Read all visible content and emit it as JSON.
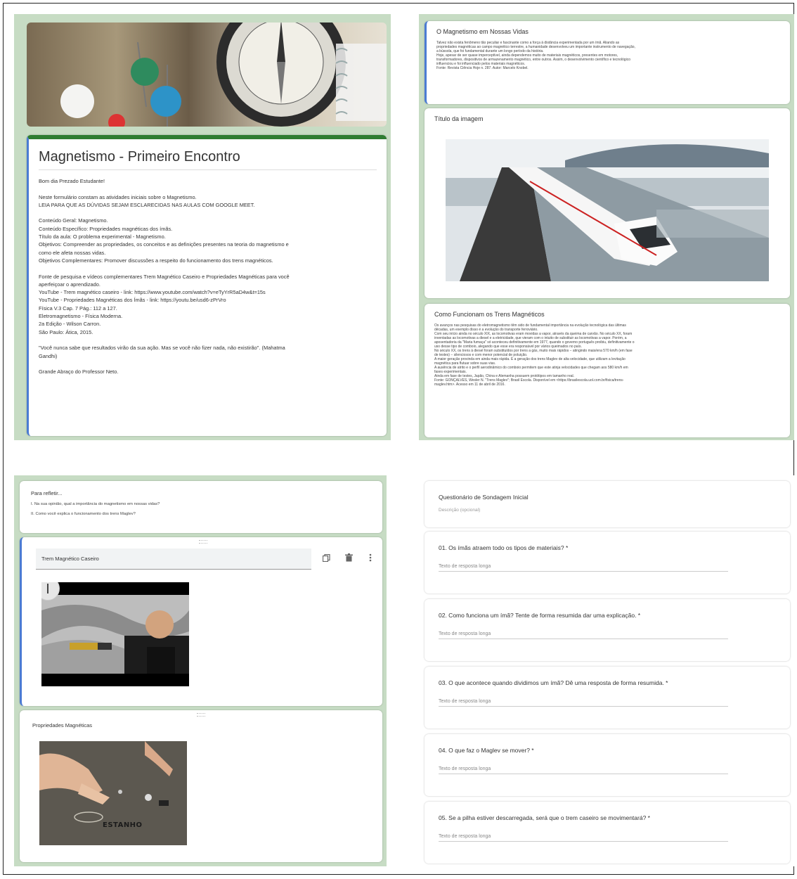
{
  "form1": {
    "title": "Magnetismo - Primeiro Encontro",
    "lines": [
      "Bom dia Prezado Estudante!",
      "",
      "Neste formulário constam as atividades iniciais sobre o Magnetismo.",
      "LEIA PARA QUE AS DÚVIDAS SEJAM ESCLARECIDAS NAS AULAS COM GOOGLE MEET.",
      "",
      "Conteúdo Geral: Magnetismo.",
      "Conteúdo Específico: Propriedades magnéticas dos ímãs.",
      "Título da aula: O problema experimental - Magnetismo.",
      "Objetivos: Compreender as propriedades, os conceitos e as definições presentes na teoria do magnetismo e",
      "como ele afeta nossas vidas.",
      "Objetivos Complementares: Promover discussões a respeito do funcionamento dos trens magnéticos.",
      "",
      "Fonte de pesquisa e vídeos complementares Trem Magnético Caseiro e Propriedades Magnéticas para você",
      "aperfeiçoar o aprendizado.",
      "YouTube - Trem magnético caseiro - link: https://www.youtube.com/watch?v=eTyYrR5aD4w&t=15s",
      "YouTube - Propriedades Magnéticas dos Ímãs - link: https://youtu.be/usd6-zPrVro",
      "Física V.3 Cap. 7 Pág.: 112 a 127.",
      "Eletromagnetismo - Física Moderna.",
      "2a Edição - Wilson Carron.",
      "São Paulo: Ática, 2015.",
      "",
      "\"Você nunca sabe que resultados virão da sua ação. Mas se você não fizer nada, não existirão\". (Mahatma",
      "Gandhi)",
      "",
      "Grande Abraço do Professor Neto."
    ]
  },
  "form2": {
    "section1_title": "O Magnetismo em Nossas Vidas",
    "section1_text": [
      "Talvez não exista fenômeno tão peculiar e fascinante como a força à distância experimentada por um ímã. Aliando as",
      "propriedades magnéticas ao campo magnético terrestre, a humanidade desenvolveu um importante instrumento de navegação,",
      "a bússola, que foi fundamental durante um longo período da história.",
      "Hoje, apesar de ser quase imperceptível, ainda dependemos muito de materiais magnéticos, presentes em motores,",
      "transformadores, dispositivos de armazenamento magnético, entre outros. Assim, o desenvolvimento científico e tecnológico",
      "influenciou e foi influenciado pelos materiais magnéticos.",
      "Fonte: Revista Ciência Hoje n. 287. Autor: Marcelo Knobel."
    ],
    "image_title": "Título da imagem",
    "section2_title": "Como Funcionam os Trens Magnéticos",
    "section2_text": [
      "Os avanços nas pesquisas do eletromagnetismo têm sido de fundamental importância na evolução tecnológica das últimas",
      "décadas, um exemplo disso é a evolução do transporte ferroviário.",
      "Com seu início ainda no século XIX, as locomotivas eram movidas a vapor, através da queima de carvão. No século XX, foram",
      "inventadas as locomotivas a diesel e a eletricidade, que vieram com o intuito de substituir as locomotivas a vapor. Porém, a",
      "aposentadoria da \"Maria fumaça\" só aconteceu definitivamente em 1977, quando o governo português proibiu, definitivamente o",
      "uso desse tipo de comboio, alegando que esse era responsável por vários queimados no país.",
      "No século XX, os trens à diesel foram substituídos por trens a gás, muito mais rápidos − atingindo mais/ena 570 km/h (em fase",
      "de testes) − silenciosos e com menor potencial de poluição.",
      "A maior geração provinda em ainda mais rápida. É a geração dos trens Maglev de alta velocidade, que utilizam a levitação",
      "magnética para flutuar sobre suas vias.",
      "A ausência de atrito e o perfil aerodinâmico do comboio permitem que este atinja velocidades que chegam aos 580 km/h em",
      "fases experimentais.",
      "Ainda em fase de testes, Japão, China e Alemanha possuem protótipos em tamanho real.",
      "Fonte: GONÇALVES, Wesler N. \"Trens Maglev\"; Brasil Escola. Disponível em <https://brasilescola.uol.com.br/fisica/trens-",
      "maglev.htm>. Acesso em 11 de abril de 2016."
    ]
  },
  "form3": {
    "reflect_title": "Para refletir...",
    "reflect_items": [
      "I. Na sua opinião, qual a importância do magnetismo em nossas vidas?",
      "II. Como você explica o funcionamento dos trens Maglev?"
    ],
    "video1_title": "Trem Magnético Caseiro",
    "video2_title": "Propriedades Magnéticas",
    "video2_overlay": "ESTANHO"
  },
  "form4": {
    "title": "Questionário de Sondagem Inicial",
    "description_placeholder": "Descrição (opcional)",
    "answer_placeholder": "Texto de resposta longa",
    "questions": [
      "01. Os ímãs atraem todo os tipos de materiais? *",
      "02. Como funciona um ímã? Tente de forma resumida dar uma explicação. *",
      "03. O que acontece quando dividimos um ímã? Dê uma resposta de forma resumida. *",
      "04. O que faz o Maglev se mover? *",
      "05. Se a pilha estiver descarregada, será que o trem caseiro se movimentará? *"
    ]
  },
  "colors": {
    "panel": "#c7dcc4",
    "accent_blue": "#4b7bd3",
    "accent_green": "#2e7d32"
  },
  "icons": [
    "duplicate-icon",
    "trash-icon",
    "more-vert-icon",
    "play-icon"
  ]
}
